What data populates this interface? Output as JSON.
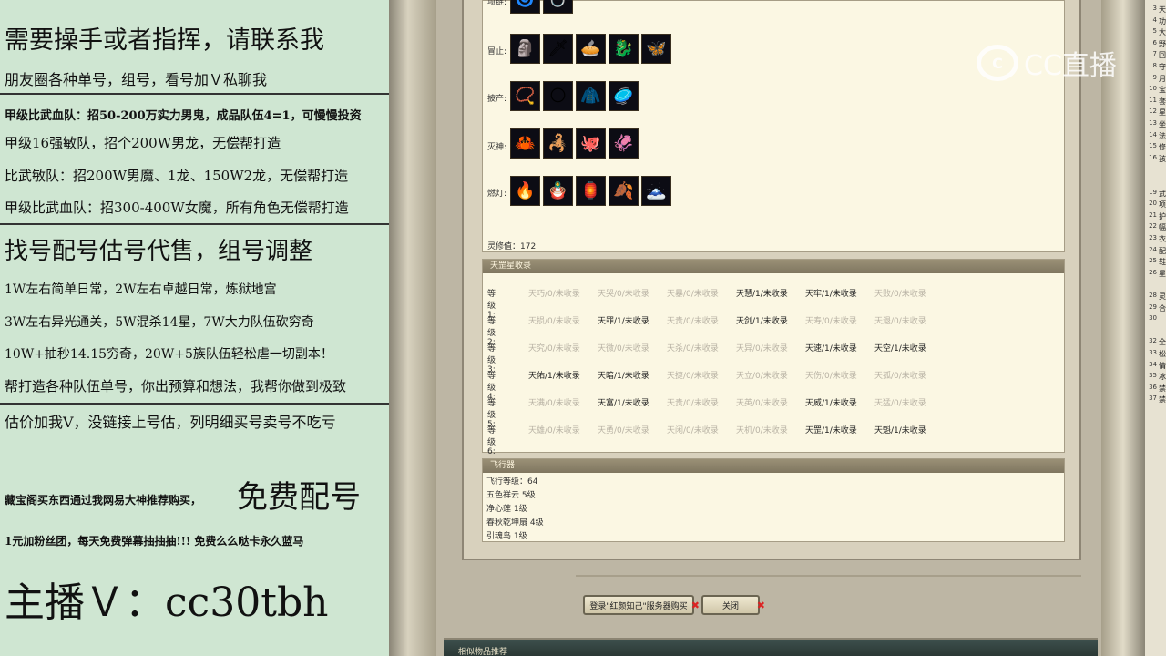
{
  "promo": {
    "lines": [
      "需要操手或者指挥，请联系我",
      "朋友圈各种单号，组号，看号加Ｖ私聊我",
      "甲级比武血队：招50-200万实力男鬼，成品队伍4=1，可慢慢投资",
      "甲级16强敏队，招个200W男龙，无偿帮打造",
      "比武敏队：招200W男魔、1龙、150W2龙，无偿帮打造",
      "甲级比武血队：招300-400W女魔，所有角色无偿帮打造",
      "找号配号估号代售，组号调整",
      "1W左右简单日常，2W左右卓越日常，炼狱地宫",
      "3W左右异光通关，5W混杀14星，7W大力队伍砍穷奇",
      "10W+抽秒14.15穷奇，20W+5族队伍轻松虐一切副本！",
      "帮打造各种队伍单号，你出预算和想法，我帮你做到极致",
      "估价加我V，没链接上号估，列明细买号卖号不吃亏",
      "藏宝阁买东西通过我网易大神推荐购买，",
      "免费配号",
      "1元加粉丝团，每天免费弹幕抽抽抽!!! 免费么么哒卡永久蓝马",
      "主播Ｖ：cc30tbh"
    ]
  },
  "equip": {
    "rows": [
      {
        "label": "项链:",
        "icons": [
          "🌀",
          "💍"
        ]
      },
      {
        "label": "冒止:",
        "icons": [
          "🗿",
          "🗡",
          "🥧",
          "🐉",
          "🦋"
        ]
      },
      {
        "label": "披产:",
        "icons": [
          "📿",
          "🌕",
          "🧥",
          "🥏"
        ]
      },
      {
        "label": "灭神:",
        "icons": [
          "🦀",
          "🦂",
          "🐙",
          "🦑"
        ]
      },
      {
        "label": "燃灯:",
        "icons": [
          "🔥",
          "🪆",
          "🏮",
          "🍂",
          "🗻"
        ]
      }
    ],
    "spirit_value": "灵修值：172"
  },
  "tianshu": {
    "title": "天罡星收录",
    "levels": [
      {
        "label": "等级1:",
        "cells": [
          {
            "t": "天巧/0/未收录",
            "on": false
          },
          {
            "t": "天哭/0/未收录",
            "on": false
          },
          {
            "t": "天暴/0/未收录",
            "on": false
          },
          {
            "t": "天慧/1/未收录",
            "on": true
          },
          {
            "t": "天牢/1/未收录",
            "on": true
          },
          {
            "t": "天败/0/未收录",
            "on": false
          }
        ]
      },
      {
        "label": "等级2:",
        "cells": [
          {
            "t": "天损/0/未收录",
            "on": false
          },
          {
            "t": "天罪/1/未收录",
            "on": true
          },
          {
            "t": "天贵/0/未收录",
            "on": false
          },
          {
            "t": "天剑/1/未收录",
            "on": true
          },
          {
            "t": "天寿/0/未收录",
            "on": false
          },
          {
            "t": "天退/0/未收录",
            "on": false
          }
        ]
      },
      {
        "label": "等级3:",
        "cells": [
          {
            "t": "天究/0/未收录",
            "on": false
          },
          {
            "t": "天微/0/未收录",
            "on": false
          },
          {
            "t": "天杀/0/未收录",
            "on": false
          },
          {
            "t": "天异/0/未收录",
            "on": false
          },
          {
            "t": "天速/1/未收录",
            "on": true
          },
          {
            "t": "天空/1/未收录",
            "on": true
          }
        ]
      },
      {
        "label": "等级4:",
        "cells": [
          {
            "t": "天佑/1/未收录",
            "on": true
          },
          {
            "t": "天暗/1/未收录",
            "on": true
          },
          {
            "t": "天捷/0/未收录",
            "on": false
          },
          {
            "t": "天立/0/未收录",
            "on": false
          },
          {
            "t": "天伤/0/未收录",
            "on": false
          },
          {
            "t": "天孤/0/未收录",
            "on": false
          }
        ]
      },
      {
        "label": "等级5:",
        "cells": [
          {
            "t": "天满/0/未收录",
            "on": false
          },
          {
            "t": "天富/1/未收录",
            "on": true
          },
          {
            "t": "天贵/0/未收录",
            "on": false
          },
          {
            "t": "天英/0/未收录",
            "on": false
          },
          {
            "t": "天威/1/未收录",
            "on": true
          },
          {
            "t": "天猛/0/未收录",
            "on": false
          }
        ]
      },
      {
        "label": "等级6:",
        "cells": [
          {
            "t": "天雄/0/未收录",
            "on": false
          },
          {
            "t": "天勇/0/未收录",
            "on": false
          },
          {
            "t": "天闲/0/未收录",
            "on": false
          },
          {
            "t": "天机/0/未收录",
            "on": false
          },
          {
            "t": "天罡/1/未收录",
            "on": true
          },
          {
            "t": "天魁/1/未收录",
            "on": true
          }
        ]
      }
    ]
  },
  "flyer": {
    "title": "飞行器",
    "lines": [
      "飞行等级：64",
      "五色祥云  5级",
      "净心莲  1级",
      "春秋乾坤扇  4级",
      "引魂鸟  1级"
    ]
  },
  "buttons": {
    "login_buy": "登录\"红颜知己\"服务器购买",
    "close": "关闭",
    "x_mark": "✖"
  },
  "bottom_bar": {
    "title": "相似物品推荐"
  },
  "logo": {
    "text": "CC直播",
    "mark": "C"
  },
  "strip": {
    "nums": [
      "3",
      "4",
      "5",
      "6",
      "7",
      "8",
      "9",
      "10",
      "11",
      "12",
      "13",
      "14",
      "15",
      "16",
      "",
      "",
      "19",
      "20",
      "21",
      "22",
      "23",
      "24",
      "25",
      "26",
      "",
      "28",
      "29",
      "30",
      "",
      "32",
      "33",
      "34",
      "35",
      "36",
      "37"
    ],
    "chars": [
      "天",
      "功",
      "大",
      "野",
      "回",
      "守",
      "月",
      "宝",
      "套",
      "星",
      "坐",
      "法",
      "修",
      "孩",
      "",
      "",
      "武",
      "项",
      "护",
      "幅",
      "衣",
      "配",
      "鞋",
      "星",
      "",
      "灵",
      "合",
      "",
      "",
      "全",
      "松",
      "情",
      "冰",
      "禁",
      "禁"
    ]
  },
  "colors": {
    "promo_bg": "#cfe6d2",
    "panel_bg": "#fbf7e3",
    "header": "#8b8169",
    "close_x": "#dd2222"
  }
}
